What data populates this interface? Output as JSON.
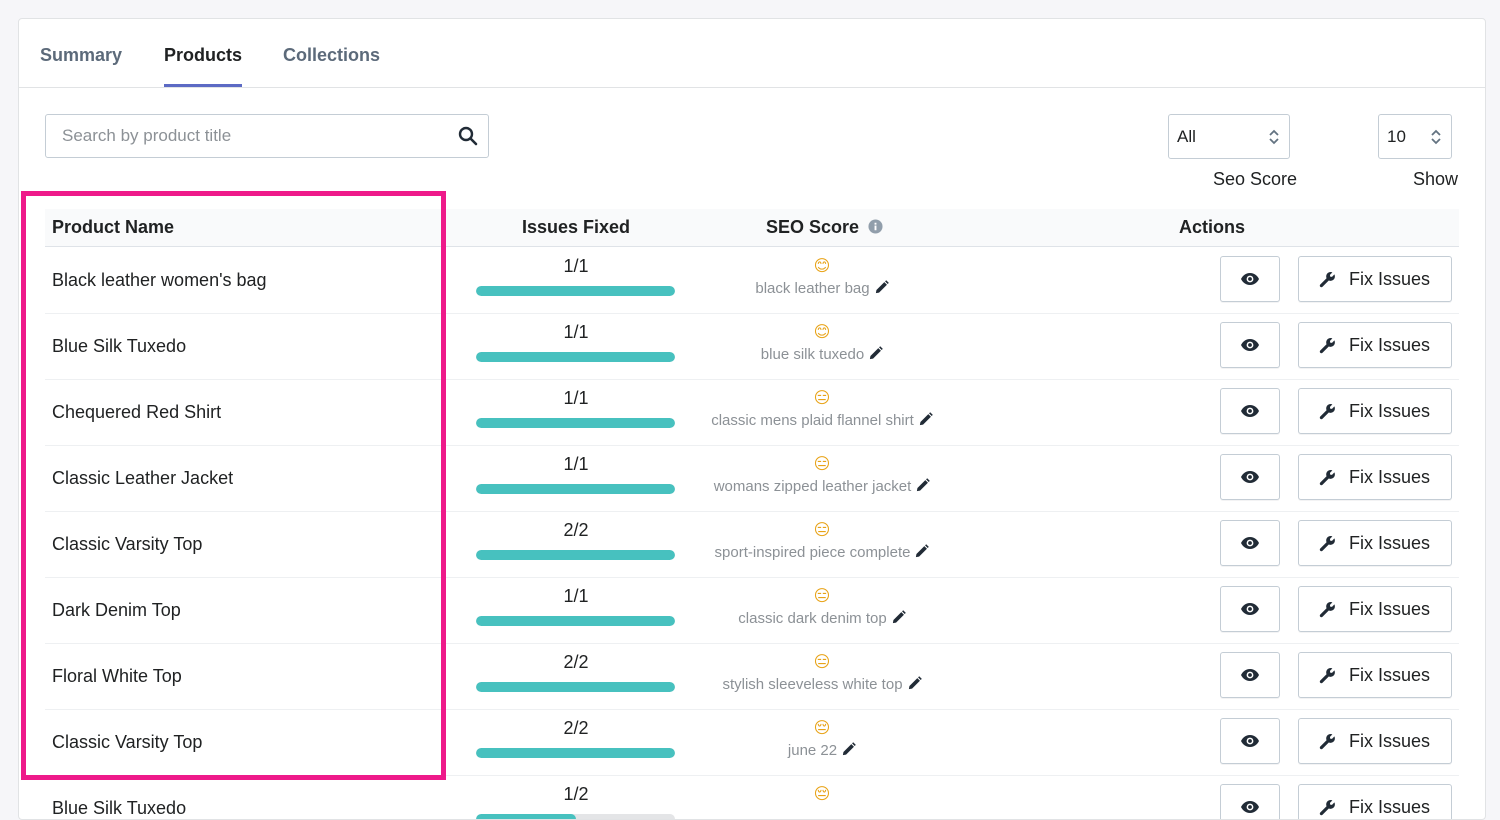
{
  "tabs": [
    {
      "label": "Summary",
      "active": false
    },
    {
      "label": "Products",
      "active": true
    },
    {
      "label": "Collections",
      "active": false
    }
  ],
  "search": {
    "placeholder": "Search by product title",
    "value": ""
  },
  "seo_filter": {
    "value": "All",
    "label": "Seo Score"
  },
  "show_filter": {
    "value": "10",
    "label": "Show"
  },
  "columns": {
    "product_name": "Product Name",
    "issues_fixed": "Issues Fixed",
    "seo_score": "SEO Score",
    "actions": "Actions"
  },
  "fix_label": "Fix Issues",
  "colors": {
    "accent": "#5c6ac4",
    "progress": "#47c1bf",
    "highlight": "#ee1a8a"
  },
  "rows": [
    {
      "name": "Black leather women's bag",
      "fixed": "1/1",
      "progress": 1.0,
      "emoji": "😊",
      "keyword": "black leather bag"
    },
    {
      "name": "Blue Silk Tuxedo",
      "fixed": "1/1",
      "progress": 1.0,
      "emoji": "😊",
      "keyword": "blue silk tuxedo"
    },
    {
      "name": "Chequered Red Shirt",
      "fixed": "1/1",
      "progress": 1.0,
      "emoji": "😑",
      "keyword": "classic mens plaid flannel shirt"
    },
    {
      "name": "Classic Leather Jacket",
      "fixed": "1/1",
      "progress": 1.0,
      "emoji": "😑",
      "keyword": "womans zipped leather jacket"
    },
    {
      "name": "Classic Varsity Top",
      "fixed": "2/2",
      "progress": 1.0,
      "emoji": "😑",
      "keyword": "sport-inspired piece complete"
    },
    {
      "name": "Dark Denim Top",
      "fixed": "1/1",
      "progress": 1.0,
      "emoji": "😑",
      "keyword": "classic dark denim top"
    },
    {
      "name": "Floral White Top",
      "fixed": "2/2",
      "progress": 1.0,
      "emoji": "😑",
      "keyword": "stylish sleeveless white top"
    },
    {
      "name": "Classic Varsity Top",
      "fixed": "2/2",
      "progress": 1.0,
      "emoji": "😔",
      "keyword": "june 22"
    },
    {
      "name": "Blue Silk Tuxedo",
      "fixed": "1/2",
      "progress": 0.5,
      "emoji": "😔",
      "keyword": ""
    }
  ]
}
